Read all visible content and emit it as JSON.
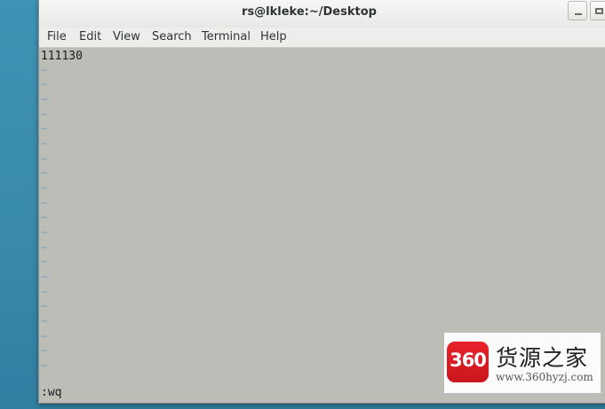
{
  "window": {
    "title": "rs@lkleke:~/Desktop"
  },
  "menu": {
    "items": [
      "File",
      "Edit",
      "View",
      "Search",
      "Terminal",
      "Help"
    ]
  },
  "terminal": {
    "first_line": "111130",
    "empty_line_marker": "~",
    "command_line": ":wq"
  },
  "watermark": {
    "logo_text": "360",
    "brand_text": "货源之家",
    "url_text": "www.360hyzj.com"
  },
  "colors": {
    "desktop": "#3a8bab",
    "terminal_bg": "#bbbdb6",
    "tilde": "#7fa3c4",
    "logo_red": "#e8232b"
  }
}
